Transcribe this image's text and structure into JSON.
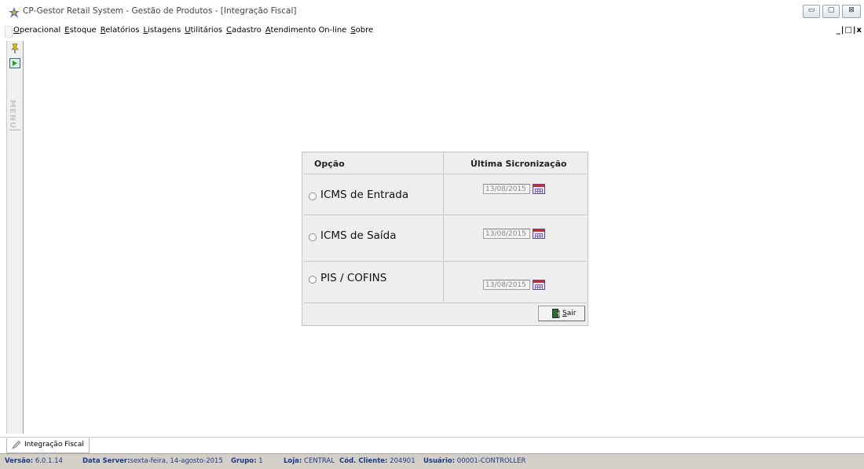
{
  "window": {
    "title": "CP-Gestor Retail System - Gestão de Produtos - [Integração Fiscal]",
    "mdi_controls": "_ | ̅̅̅ | x"
  },
  "menu": {
    "items": [
      "Operacional",
      "Estoque",
      "Relatórios",
      "Listagens",
      "Utilitários",
      "Cadastro",
      "Atendimento On-line",
      "Sobre"
    ],
    "mdi_controls": "_|\u0000|x"
  },
  "sidebar": {
    "vertical_label": "MENU"
  },
  "panel": {
    "header_option": "Opção",
    "header_sync": "Última Sicronização",
    "rows": [
      {
        "label": "ICMS de Entrada",
        "date": "13/08/2015",
        "selected": false
      },
      {
        "label": "ICMS de Saída",
        "date": "13/08/2015",
        "selected": false
      },
      {
        "label": "PIS / COFINS",
        "date": "13/08/2015",
        "selected": false
      }
    ],
    "exit_label": "Sair"
  },
  "tabs": [
    {
      "label": "Integração Fiscal"
    }
  ],
  "status": {
    "versao_label": "Versão:",
    "versao": "6.0.1.14",
    "server_label": "Data Server:",
    "server": "sexta-feira, 14-agosto-2015",
    "grupo_label": "Grupo:",
    "grupo": "1",
    "loja_label": "Loja:",
    "loja": "CENTRAL",
    "cliente_label": "Cód. Cliente:",
    "cliente": "204901",
    "usuario_label": "Usuário:",
    "usuario": "00001-CONTROLLER"
  },
  "colors": {
    "status_text": "#1d3a8a",
    "panel_bg": "#eeeeee",
    "status_bg": "#d4d0c8"
  }
}
